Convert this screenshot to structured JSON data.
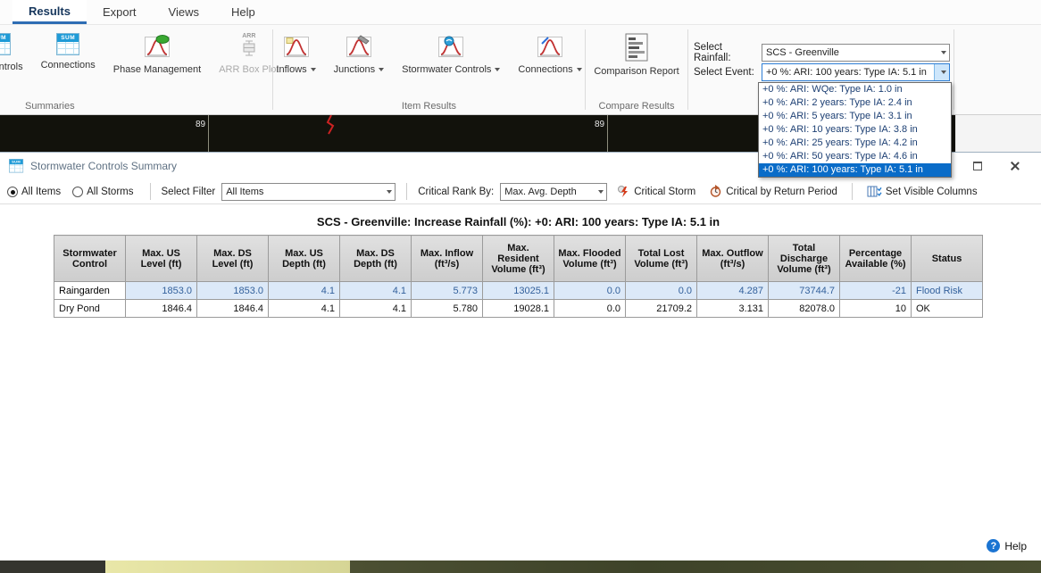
{
  "colors": {
    "accent_blue": "#2e6db4",
    "selection_blue": "#0a6cc8",
    "row_highlight_bg": "#dce9f8",
    "row_highlight_text": "#33619c",
    "curve_red": "#c23232",
    "help_blue": "#1b74d2"
  },
  "tabs": [
    {
      "label": "Results",
      "active": true
    },
    {
      "label": "Export",
      "active": false
    },
    {
      "label": "Views",
      "active": false
    },
    {
      "label": "Help",
      "active": false
    }
  ],
  "ribbon": {
    "sum_icon_text": "SUM",
    "arr_icon_text": "ARR",
    "summaries": {
      "group_label": "Summaries",
      "item_cut_label": "ontrols",
      "connections_label": "Connections",
      "phase_label": "Phase Management",
      "arr_label": "ARR Box Plot"
    },
    "item_results": {
      "group_label": "Item Results",
      "inflows_label": "Inflows",
      "junctions_label": "Junctions",
      "stormwater_label": "Stormwater Controls",
      "connections_label": "Connections"
    },
    "compare": {
      "group_label": "Compare Results",
      "report_label": "Comparison Report"
    },
    "rainfall_label": "Select Rainfall:",
    "rainfall_value": "SCS - Greenville",
    "event_label": "Select Event:",
    "event_value": "+0 %: ARI: 100 years: Type IA: 5.1 in",
    "event_options": [
      "+0 %: ARI: WQe: Type IA: 1.0 in",
      "+0 %: ARI: 2 years: Type IA: 2.4 in",
      "+0 %: ARI: 5 years: Type IA: 3.1 in",
      "+0 %: ARI: 10 years: Type IA: 3.8 in",
      "+0 %: ARI: 25 years: Type IA: 4.2 in",
      "+0 %: ARI: 50 years: Type IA: 4.6 in",
      "+0 %: ARI: 100 years: Type IA: 5.1 in"
    ],
    "selected_event_index": 6
  },
  "map": {
    "label_left": "89",
    "label_right": "89"
  },
  "dialog": {
    "title": "Stormwater Controls Summary",
    "toolbar": {
      "radio_all_items": "All Items",
      "radio_all_storms": "All Storms",
      "select_filter_label": "Select Filter",
      "select_filter_value": "All Items",
      "critical_rank_label": "Critical Rank By:",
      "critical_rank_value": "Max. Avg. Depth",
      "critical_storm": "Critical Storm",
      "critical_by_return": "Critical by Return Period",
      "set_visible_columns": "Set Visible Columns"
    },
    "table_title": "SCS - Greenville: Increase Rainfall (%): +0: ARI: 100 years: Type IA: 5.1 in",
    "table": {
      "columns": [
        "Stormwater Control",
        "Max. US Level (ft)",
        "Max. DS Level (ft)",
        "Max. US Depth (ft)",
        "Max. DS Depth (ft)",
        "Max. Inflow (ft³/s)",
        "Max. Resident Volume (ft³)",
        "Max. Flooded Volume (ft³)",
        "Total Lost Volume (ft³)",
        "Max. Outflow (ft³/s)",
        "Total Discharge Volume (ft³)",
        "Percentage Available (%)",
        "Status"
      ],
      "rows": [
        {
          "highlighted": true,
          "cells": [
            "Raingarden",
            "1853.0",
            "1853.0",
            "4.1",
            "4.1",
            "5.773",
            "13025.1",
            "0.0",
            "0.0",
            "4.287",
            "73744.7",
            "-21",
            "Flood Risk"
          ]
        },
        {
          "highlighted": false,
          "cells": [
            "Dry Pond",
            "1846.4",
            "1846.4",
            "4.1",
            "4.1",
            "5.780",
            "19028.1",
            "0.0",
            "21709.2",
            "3.131",
            "82078.0",
            "10",
            "OK"
          ]
        }
      ]
    },
    "help_glyph": "?",
    "help_label": "Help"
  }
}
